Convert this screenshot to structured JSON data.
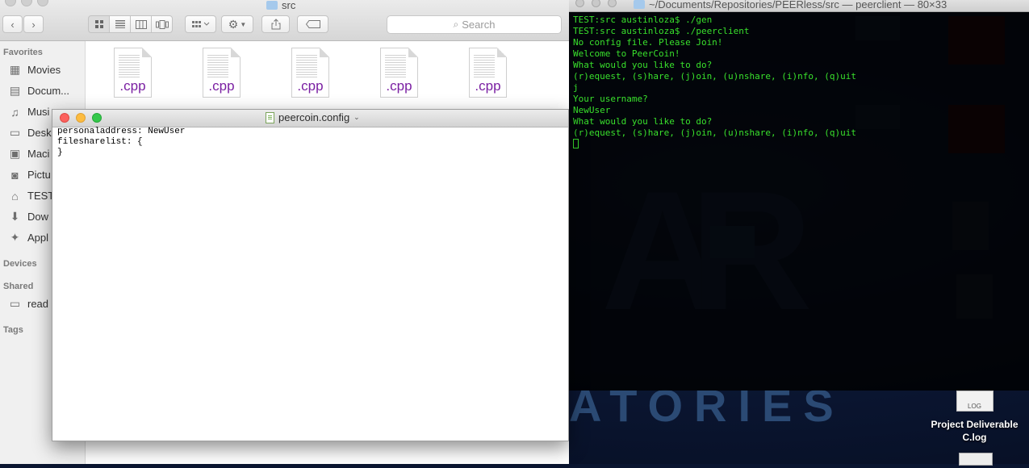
{
  "finder": {
    "title": "src",
    "search_placeholder": "Search",
    "sidebar": {
      "favorites_header": "Favorites",
      "favorites": [
        {
          "label": "Movies",
          "icon": "film-icon"
        },
        {
          "label": "Docum...",
          "icon": "documents-icon"
        },
        {
          "label": "Musi",
          "icon": "music-icon"
        },
        {
          "label": "Desk",
          "icon": "desktop-icon"
        },
        {
          "label": "Maci",
          "icon": "hard-drive-icon"
        },
        {
          "label": "Pictu",
          "icon": "camera-icon"
        },
        {
          "label": "TEST",
          "icon": "home-icon"
        },
        {
          "label": "Dow",
          "icon": "download-icon"
        },
        {
          "label": "Appl",
          "icon": "applications-icon"
        }
      ],
      "devices_header": "Devices",
      "shared_header": "Shared",
      "shared": [
        {
          "label": "read",
          "icon": "monitor-icon"
        }
      ],
      "tags_header": "Tags"
    },
    "files": [
      {
        "ext": ".cpp"
      },
      {
        "ext": ".cpp"
      },
      {
        "ext": ".cpp"
      },
      {
        "ext": ".cpp"
      },
      {
        "ext": ".cpp"
      }
    ]
  },
  "textedit": {
    "title": "peercoin.config",
    "content": "personaladdress: NewUser\nfilesharelist: {\n}"
  },
  "terminal": {
    "title": "~/Documents/Repositories/PEERless/src — peerclient — 80×33",
    "lines": [
      "TEST:src austinloza$ ./gen",
      "TEST:src austinloza$ ./peerclient",
      "No config file. Please Join!",
      "Welcome to PeerCoin!",
      "What would you like to do?",
      "(r)equest, (s)hare, (j)oin, (u)nshare, (i)nfo, (q)uit",
      "j",
      "Your username?",
      "NewUser",
      "What would you like to do?",
      "(r)equest, (s)hare, (j)oin, (u)nshare, (i)nfo, (q)uit"
    ],
    "text_color": "#39e02c"
  },
  "desktop": {
    "file_icon_text": "LOG",
    "file_label": "Project Deliverable C.log"
  },
  "colors": {
    "file_extension": "#7a1fa2",
    "traffic_close": "#fc615d",
    "traffic_minimize": "#fdbc40",
    "traffic_zoom": "#34c84a"
  }
}
